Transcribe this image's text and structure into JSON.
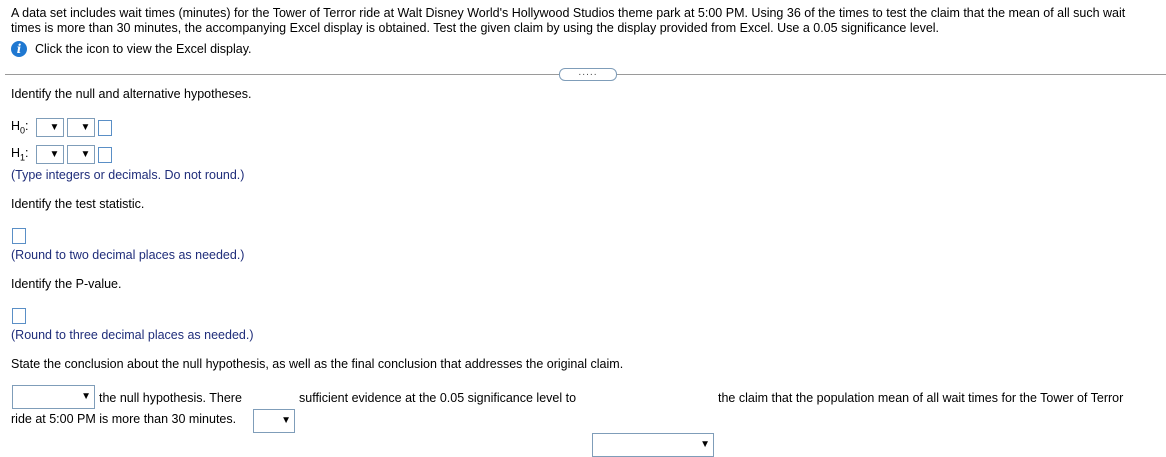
{
  "problem": {
    "text": "A data set includes wait times (minutes) for the Tower of Terror ride at Walt Disney World's Hollywood Studios theme park at 5:00 PM. Using 36 of the times to test the claim that the mean of all such wait times is more than 30 minutes, the accompanying Excel display is obtained. Test the given claim by using the display provided from Excel. Use a 0.05 significance level.",
    "info_text": "Click the icon to view the Excel display."
  },
  "expand_label": ".....",
  "q1": {
    "prompt": "Identify the null and alternative hypotheses.",
    "h0_label": "H",
    "h0_sub": "0",
    "h1_label": "H",
    "h1_sub": "1",
    "hint": "(Type integers or decimals. Do not round.)"
  },
  "q2": {
    "prompt": "Identify the test statistic.",
    "hint": "(Round to two decimal places as needed.)"
  },
  "q3": {
    "prompt": "Identify the P-value.",
    "hint": "(Round to three decimal places as needed.)"
  },
  "q4": {
    "prompt": "State the conclusion about the null hypothesis, as well as the final conclusion that addresses the original claim.",
    "text1": "the null hypothesis. There",
    "text2": "sufficient evidence at the 0.05 significance level to",
    "text3": "the claim that the population mean of all wait times for the Tower of Terror",
    "text4": "ride at 5:00 PM is more than 30 minutes."
  },
  "icons": {
    "info": "info-icon",
    "dropdown": "dropdown-arrow-icon"
  },
  "colors": {
    "info_icon": "#1f78d1",
    "hint_text": "#1f2d7a",
    "input_border": "#5a8fc6"
  }
}
